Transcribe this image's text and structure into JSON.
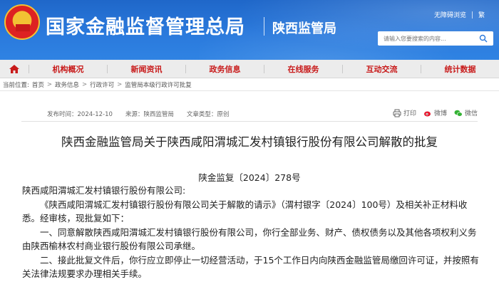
{
  "header": {
    "brand": "国家金融监督管理总局",
    "sub_brand": "陕西监管局",
    "top_links": [
      "无障碍浏览",
      "繁"
    ],
    "search_placeholder": "请输入您要搜索的内容..."
  },
  "nav": {
    "items": [
      "机构概况",
      "新闻资讯",
      "政务信息",
      "在线服务",
      "互动交流",
      "统计数据"
    ]
  },
  "breadcrumb": {
    "prefix": "当前位置:",
    "items": [
      "首页",
      "政务信息",
      "行政许可",
      "监管局本级行政许可批复"
    ]
  },
  "meta": {
    "published": "发布时间：2024-12-10",
    "source": "来源：陕西监管局",
    "type": "文章类型：原创"
  },
  "share": {
    "print": "打印",
    "weibo": "微博",
    "wechat": "微信"
  },
  "document": {
    "title": "陕西金融监管局关于陕西咸阳渭城汇发村镇银行股份有限公司解散的批复",
    "number": "陕金监复〔2024〕278号",
    "addressee": "陕西咸阳渭城汇发村镇银行股份有限公司:",
    "paragraphs": [
      "《陕西咸阳渭城汇发村镇银行股份有限公司关于解散的请示》（渭村银字〔2024〕100号）及相关补正材料收悉。经审核，现批复如下：",
      "一、同意解散陕西咸阳渭城汇发村镇银行股份有限公司，你行全部业务、财产、债权债务以及其他各项权利义务由陕西榆林农村商业银行股份有限公司承继。",
      "二、接此批复文件后，你行应立即停止一切经营活动，于15个工作日内向陕西金融监管局缴回许可证，并按照有关法律法规要求办理相关手续。"
    ]
  },
  "colors": {
    "header_blue": "#2a79dc",
    "nav_text_red": "#c81a1a"
  }
}
